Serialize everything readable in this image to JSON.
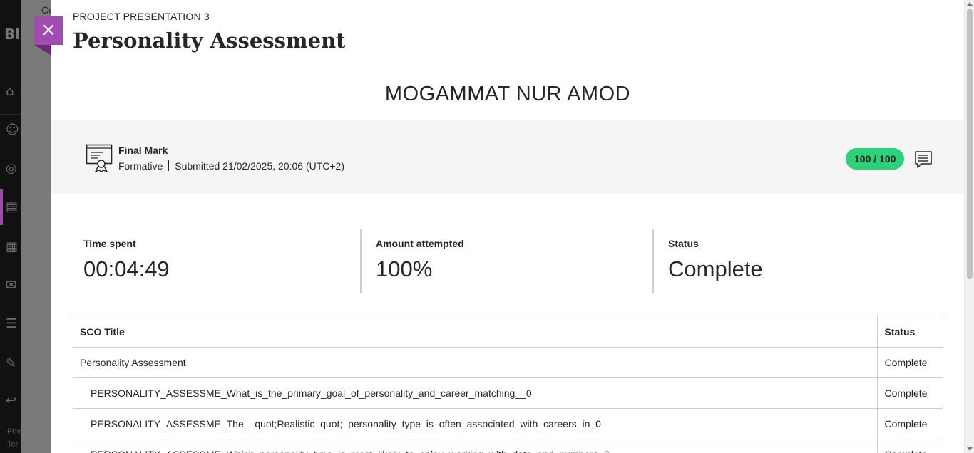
{
  "background": {
    "logo": "Bl",
    "breadcrumb": "Co",
    "footer_lines": [
      "Priv",
      "Ter"
    ]
  },
  "panel": {
    "kicker": "PROJECT PRESENTATION 3",
    "title": "Personality Assessment",
    "close_label": "×"
  },
  "student": {
    "name": "MOGAMMAT NUR AMOD"
  },
  "grade": {
    "title": "Final Mark",
    "type": "Formative",
    "submitted": "Submitted 21/02/2025, 20:06 (UTC+2)",
    "score": "100 / 100",
    "score_color": "#2bd27a"
  },
  "stats": [
    {
      "label": "Time spent",
      "value": "00:04:49"
    },
    {
      "label": "Amount attempted",
      "value": "100%"
    },
    {
      "label": "Status",
      "value": "Complete"
    }
  ],
  "table": {
    "headers": [
      "SCO Title",
      "Status"
    ],
    "rows": [
      {
        "title": "Personality Assessment",
        "status": "Complete"
      },
      {
        "title": "PERSONALITY_ASSESSME_What_is_the_primary_goal_of_personality_and_career_matching__0",
        "status": "Complete"
      },
      {
        "title": "PERSONALITY_ASSESSME_The__quot;Realistic_quot;_personality_type_is_often_associated_with_careers_in_0",
        "status": "Complete"
      },
      {
        "title": "PERSONALITY_ASSESSME_Which_personality_type_is_most_likely_to_enjoy_working_with_data_and_numbers_0",
        "status": "Complete"
      }
    ]
  },
  "accent_color": "#a04db0"
}
